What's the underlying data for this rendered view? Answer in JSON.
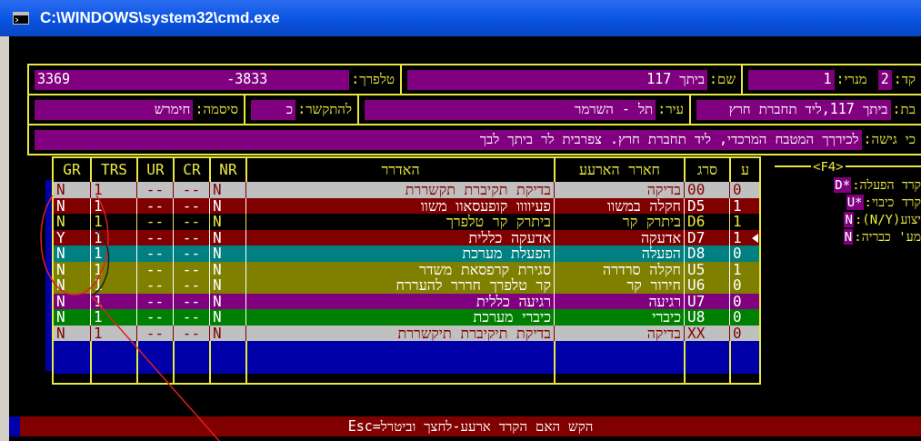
{
  "window": {
    "title": "C:\\WINDOWS\\system32\\cmd.exe"
  },
  "form_rows": [
    {
      "cells": [
        {
          "fields": [
            {
              "label": "קד:",
              "values": [
                "2"
              ]
            },
            {
              "label": "מנרי:",
              "values": [
                "1"
              ]
            }
          ]
        },
        {
          "fields": [
            {
              "label": "שם:",
              "values": [
                "ביתך 117"
              ]
            }
          ]
        },
        {
          "fields": [
            {
              "label": "טלפרך:",
              "values": [
                "-3833",
                "3369"
              ]
            }
          ]
        }
      ]
    },
    {
      "cells": [
        {
          "fields": [
            {
              "label": "בת:",
              "values": [
                "ביתך 117,ליד תחברת חרץ"
              ]
            }
          ]
        },
        {
          "fields": [
            {
              "label": "עיר:",
              "values": [
                "תל - השרמר"
              ]
            }
          ]
        },
        {
          "fields": [
            {
              "label": "להתקשר:",
              "values": [
                "כ"
              ]
            }
          ]
        },
        {
          "fields": [
            {
              "label": "סיסמה:",
              "values": [
                "חימרש"
              ]
            }
          ]
        }
      ]
    },
    {
      "cells": [
        {
          "fields": [
            {
              "label": "כי גישה:",
              "values": [
                "לכירךך המטבח המרכדי, ליד תחברת חרץ. צפרבית לר ביתך לבך"
              ]
            }
          ]
        }
      ]
    }
  ],
  "table": {
    "columns": [
      "ע",
      "סרג",
      "חארר הארעע",
      "האדרר",
      "NR",
      "CR",
      "UR",
      "TRS",
      "GR"
    ],
    "rows": [
      {
        "cells": [
          "0",
          "00",
          "בדיקה",
          "בדיקת תקיברת תקשררת",
          "N",
          "--",
          "--",
          "1",
          "N"
        ],
        "color": "#c0c0c0",
        "selected": false
      },
      {
        "cells": [
          "1",
          "D5",
          "חקלה במשוו",
          "פעיוווו קופעסאוו משוו",
          "N",
          "--",
          "--",
          "1",
          "N"
        ],
        "color": "#800000",
        "selected": false
      },
      {
        "cells": [
          "1",
          "D6",
          "ביתרק קר",
          "ביתרק קר טלפרך",
          "N",
          "--",
          "--",
          "1",
          "N"
        ],
        "color": "#000000",
        "selected": false
      },
      {
        "cells": [
          "1",
          "D7",
          "אדעקה",
          "אדעקה כללית",
          "N",
          "--",
          "--",
          "1",
          "Y"
        ],
        "color": "#800000",
        "selected": true
      },
      {
        "cells": [
          "0",
          "D8",
          "הפעלה",
          "הפעלת מערכת",
          "N",
          "--",
          "--",
          "1",
          "N"
        ],
        "color": "#008080",
        "selected": false
      },
      {
        "cells": [
          "1",
          "U5",
          "חקלה סרדרה",
          "סגירת קרפסאת משדר",
          "N",
          "--",
          "--",
          "1",
          "N"
        ],
        "color": "#808000",
        "selected": false
      },
      {
        "cells": [
          "0",
          "U6",
          "חירור קר",
          "קר טלפרך חררר להעררח",
          "N",
          "--",
          "--",
          "1",
          "N"
        ],
        "color": "#808000",
        "selected": false
      },
      {
        "cells": [
          "0",
          "U7",
          "רגיעה",
          "רגיעה כללית",
          "N",
          "--",
          "--",
          "1",
          "N"
        ],
        "color": "#800080",
        "selected": false
      },
      {
        "cells": [
          "0",
          "U8",
          "כיברי",
          "כיברי מערכת",
          "N",
          "--",
          "--",
          "1",
          "N"
        ],
        "color": "#008000",
        "selected": false
      },
      {
        "cells": [
          "0",
          "XX",
          "בדיקה",
          "בדיקת תיקיברת תיקשררת",
          "N",
          "--",
          "--",
          "1",
          "N"
        ],
        "color": "#c0c0c0",
        "selected": false
      }
    ]
  },
  "side_panel": {
    "title": "<F4>",
    "items": [
      {
        "label": "קרד הפעלה:",
        "value": "D*"
      },
      {
        "label": "קרד כיבוי:",
        "value": "U*"
      },
      {
        "label": "יצוע(N/Y):",
        "value": "N"
      },
      {
        "label": "מע' כבריה:",
        "value": "N"
      }
    ]
  },
  "status_bar": "הקש האם הקרד ארעע-לחצך וביטרל=Esc"
}
